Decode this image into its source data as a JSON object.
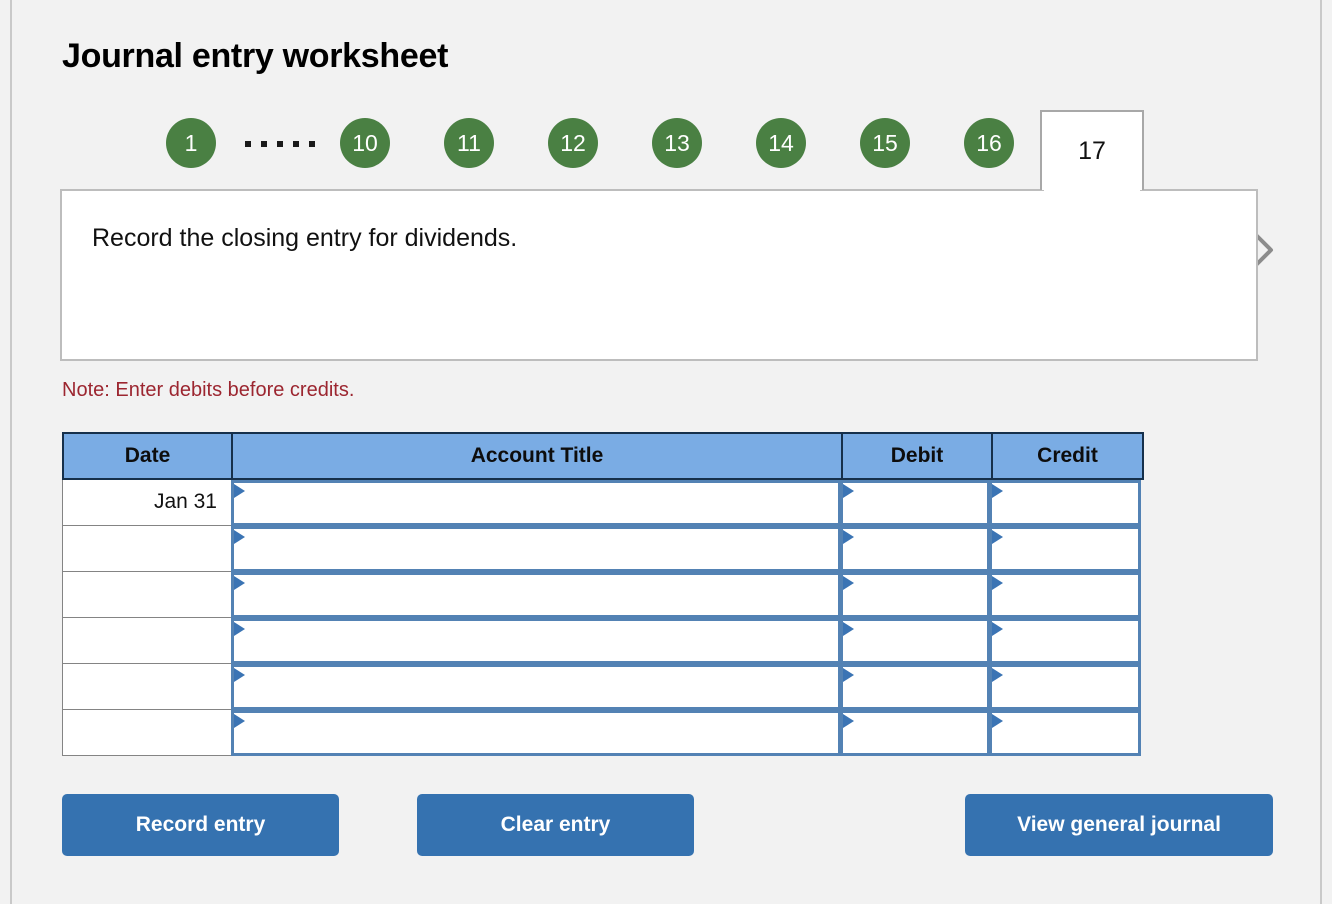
{
  "title": "Journal entry worksheet",
  "pager": {
    "prev_icon": "chevron-left-icon",
    "next_icon": "chevron-right-icon",
    "ellipsis": ".....",
    "steps": [
      "1",
      "10",
      "11",
      "12",
      "13",
      "14",
      "15",
      "16"
    ],
    "active_step": "17",
    "green": "#4a8043"
  },
  "instruction": {
    "text": "Record the closing entry for dividends."
  },
  "note": {
    "text": "Note: Enter debits before credits.",
    "color": "#9c2630"
  },
  "table": {
    "headers": {
      "date": "Date",
      "account_title": "Account Title",
      "debit": "Debit",
      "credit": "Credit"
    },
    "header_bg": "#7aace4",
    "rows": [
      {
        "date": "Jan 31",
        "account_title": "",
        "debit": "",
        "credit": ""
      },
      {
        "date": "",
        "account_title": "",
        "debit": "",
        "credit": ""
      },
      {
        "date": "",
        "account_title": "",
        "debit": "",
        "credit": ""
      },
      {
        "date": "",
        "account_title": "",
        "debit": "",
        "credit": ""
      },
      {
        "date": "",
        "account_title": "",
        "debit": "",
        "credit": ""
      },
      {
        "date": "",
        "account_title": "",
        "debit": "",
        "credit": ""
      }
    ]
  },
  "buttons": {
    "record": "Record entry",
    "clear": "Clear entry",
    "journal": "View general journal",
    "color": "#3572b0"
  }
}
